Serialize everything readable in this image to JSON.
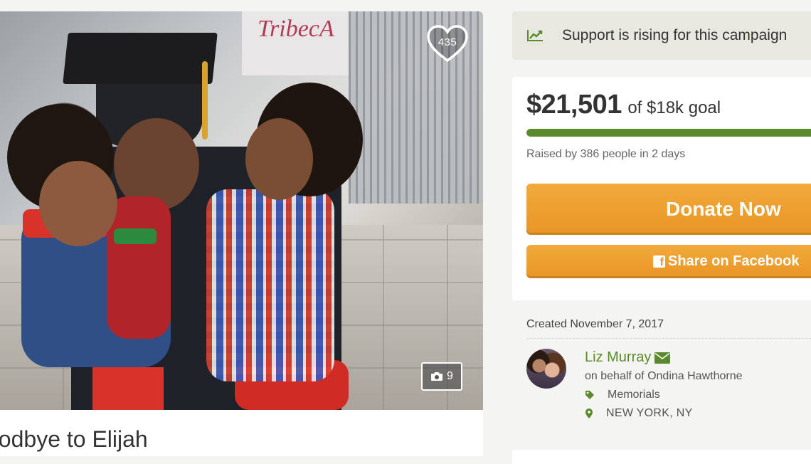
{
  "photo": {
    "likes": "435",
    "photo_count": "9"
  },
  "campaign": {
    "title": "oodbye to Elijah"
  },
  "trend": {
    "text": "Support is rising for this campaign"
  },
  "funding": {
    "raised": "$21,501",
    "goal_text": "of $18k goal",
    "progress_fraction": 1.0,
    "raised_by": "Raised by 386 people in 2 days"
  },
  "actions": {
    "donate_label": "Donate Now",
    "share_label": "Share on Facebook"
  },
  "details": {
    "created": "Created November 7, 2017",
    "organizer_name": "Liz Murray",
    "on_behalf": "on behalf of Ondina Hawthorne",
    "category": "Memorials",
    "location": "NEW YORK, NY"
  },
  "colors": {
    "accent_green": "#5a8a2b",
    "button_orange": "#e89526",
    "trend_bg": "#e8e8e0"
  },
  "icons": {
    "likes": "heart-icon",
    "photos": "camera-icon",
    "trend": "trend-chart-icon",
    "facebook": "facebook-icon",
    "email": "envelope-icon",
    "category": "tag-icon",
    "location": "map-pin-icon"
  }
}
